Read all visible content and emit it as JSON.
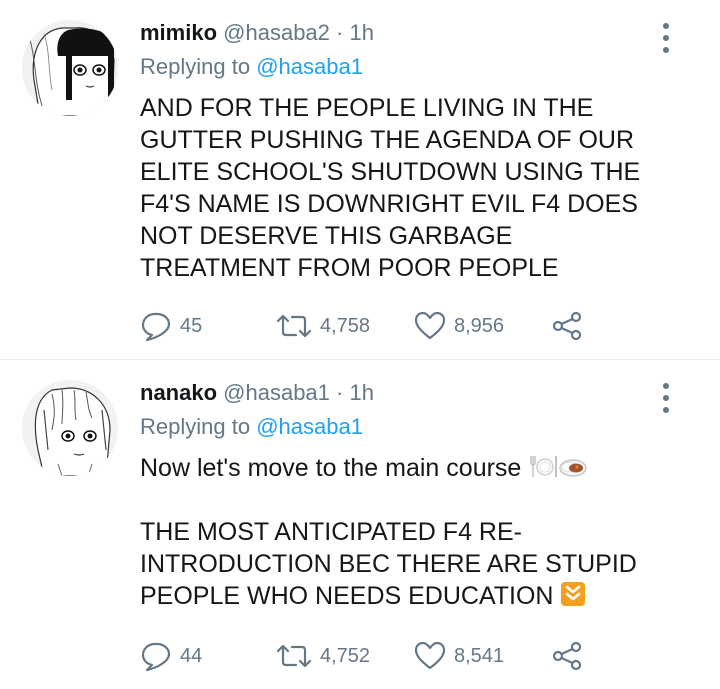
{
  "tweets": [
    {
      "display_name": "mimiko",
      "handle": "@hasaba2",
      "separator": "·",
      "time": "1h",
      "replying_prefix": "Replying to",
      "replying_to": "@hasaba1",
      "text_lines": [
        "AND FOR THE PEOPLE LIVING IN THE",
        "GUTTER PUSHING THE AGENDA OF OUR",
        "ELITE SCHOOL'S SHUTDOWN USING THE",
        "F4'S NAME IS DOWNRIGHT EVIL F4 DOES",
        "NOT DESERVE THIS GARBAGE",
        "TREATMENT FROM POOR PEOPLE"
      ],
      "reply_count": "45",
      "retweet_count": "4,758",
      "like_count": "8,956"
    },
    {
      "display_name": "nanako",
      "handle": "@hasaba1",
      "separator": "·",
      "time": "1h",
      "replying_prefix": "Replying to",
      "replying_to": "@hasaba1",
      "intro_line": "Now let's move to the main course",
      "text_lines": [
        "THE MOST ANTICIPATED F4 RE-",
        "INTRODUCTION BEC THERE ARE STUPID",
        "PEOPLE WHO NEEDS EDUCATION"
      ],
      "emojis": [
        "plate-with-cutlery-emoji",
        "curry-rice-emoji",
        "down-arrow-emoji"
      ],
      "reply_count": "44",
      "retweet_count": "4,752",
      "like_count": "8,541"
    }
  ],
  "colors": {
    "text": "#14171a",
    "secondary": "#657786",
    "mention": "#1da1f2",
    "divider": "#e6ecf0",
    "arrow_emoji": "#f4a01f"
  },
  "icons": [
    "more-options-icon",
    "reply-icon",
    "retweet-icon",
    "like-icon",
    "share-icon"
  ]
}
